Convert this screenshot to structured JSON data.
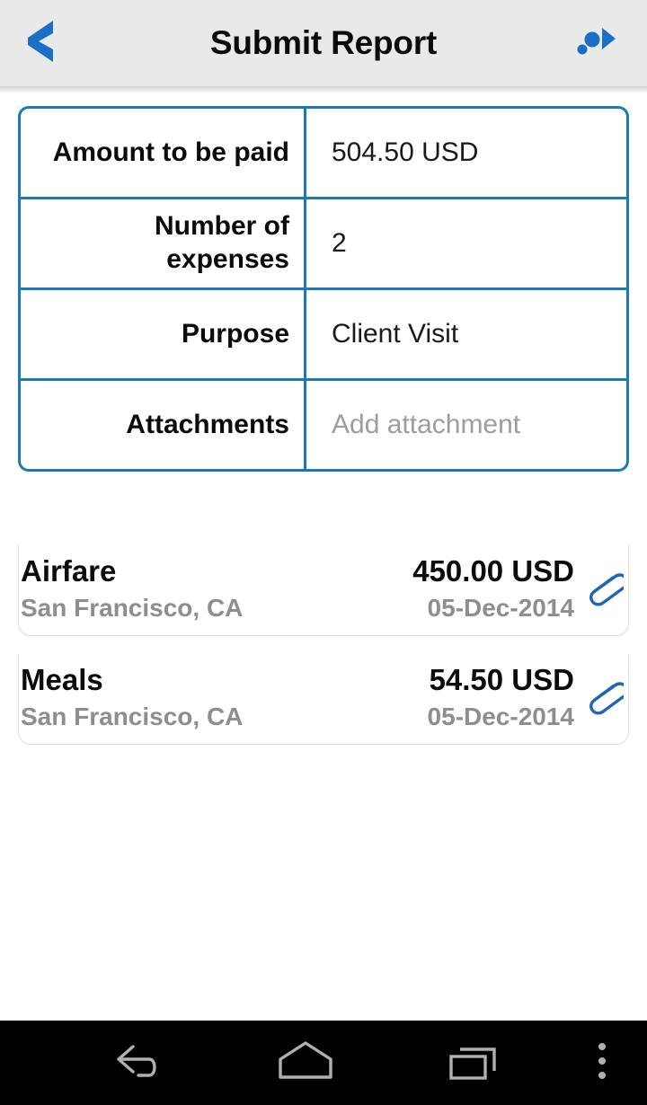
{
  "header": {
    "title": "Submit Report",
    "back_icon": "chevron-left-icon",
    "submit_icon": "send-report-icon",
    "background_color": "#e9e9e9",
    "accent_color": "#1b6fc4"
  },
  "info_table": {
    "border_color": "#1b7ab5",
    "rows": [
      {
        "label": "Amount to be paid",
        "value": "504.50 USD",
        "is_placeholder": false
      },
      {
        "label": "Number of expenses",
        "value": "2",
        "is_placeholder": false
      },
      {
        "label": "Purpose",
        "value": "Client Visit",
        "is_placeholder": false
      },
      {
        "label": "Attachments",
        "value": "Add attachment",
        "is_placeholder": true
      }
    ]
  },
  "expenses": [
    {
      "title": "Airfare",
      "amount": "450.00 USD",
      "location": "San Francisco, CA",
      "date": "05-Dec-2014",
      "attachment_icon": "paperclip-icon"
    },
    {
      "title": "Meals",
      "amount": "54.50 USD",
      "location": "San Francisco, CA",
      "date": "05-Dec-2014",
      "attachment_icon": "paperclip-icon"
    }
  ],
  "navbar": {
    "background_color": "#000000",
    "icon_color": "#b0b0b0",
    "items": [
      {
        "name": "back-icon"
      },
      {
        "name": "home-icon"
      },
      {
        "name": "recents-icon"
      },
      {
        "name": "overflow-menu-icon"
      }
    ]
  }
}
